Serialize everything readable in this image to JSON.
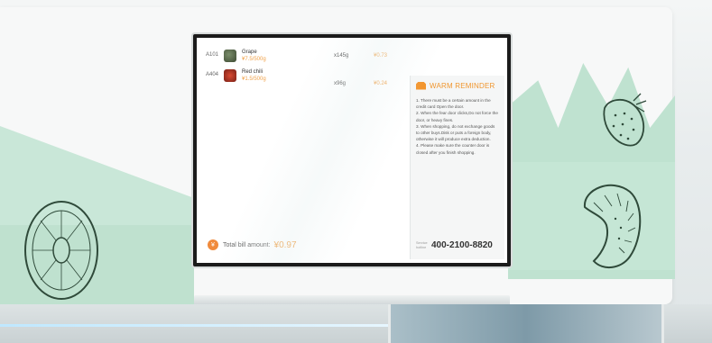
{
  "screen": {
    "items": [
      {
        "code": "A101",
        "name": "Grape",
        "unit_price": "¥7.5/500g",
        "weight": "x145g",
        "cost": "¥0.73",
        "thumb": "grape"
      },
      {
        "code": "A404",
        "name": "Red chili",
        "unit_price": "¥1.5/500g",
        "weight": "x96g",
        "cost": "¥0.24",
        "thumb": "chili"
      }
    ],
    "total_label": "Total bill amount:",
    "total_amount": "¥0.97",
    "total_icon": "¥"
  },
  "reminder": {
    "title": "WARM REMINDER",
    "icon": "gift-icon",
    "lines": [
      "1. There must be a certain amount in the credit card Open the door.",
      "2. When the fear door clicks,Do not force the door, or heavy fines.",
      "3. When shopping, do not exchange goods to other buys.Disk or puts a foreign body, otherwise it will produce extra deduction.",
      "4. Please make sure the counter door is closed after you finish shopping."
    ],
    "phone_label": "Service hotline",
    "phone": "400-2100-8820"
  },
  "colors": {
    "accent_orange": "#f0962f",
    "mint": "#c9e7d8",
    "screen_bg": "#ffffff"
  }
}
